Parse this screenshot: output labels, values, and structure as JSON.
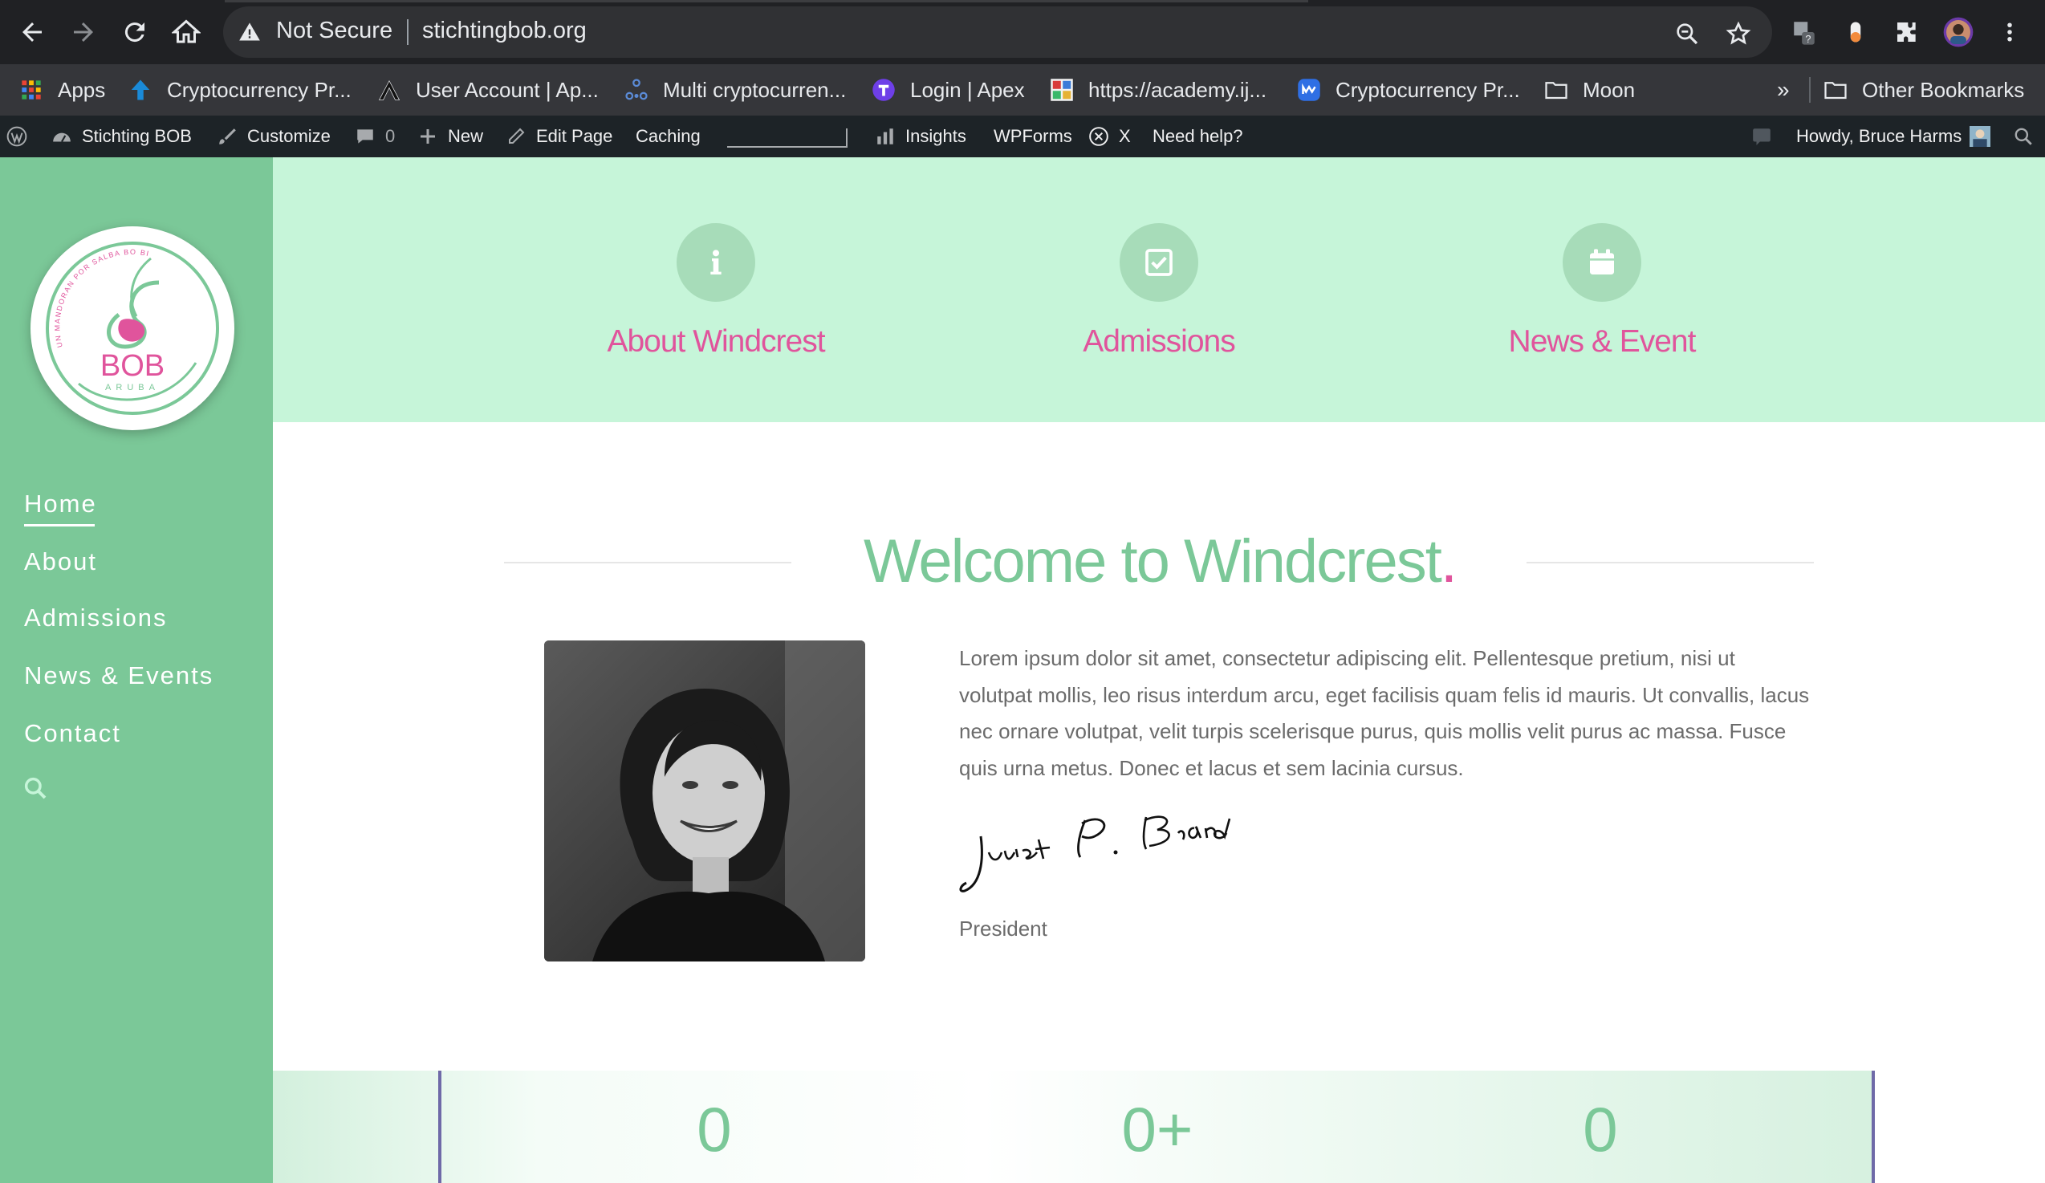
{
  "browser": {
    "security_label": "Not Secure",
    "url": "stichtingbob.org",
    "bookmarks": [
      {
        "label": "Apps",
        "icon": "apps-grid-icon"
      },
      {
        "label": "Cryptocurrency Pr...",
        "icon": "arrow-up-icon"
      },
      {
        "label": "User Account | Ap...",
        "icon": "apex-icon"
      },
      {
        "label": "Multi cryptocurren...",
        "icon": "dots-triangle-icon"
      },
      {
        "label": "Login | Apex",
        "icon": "t-circle-icon"
      },
      {
        "label": "https://academy.ij...",
        "icon": "academy-icon"
      },
      {
        "label": "Cryptocurrency Pr...",
        "icon": "coinmarketcap-icon"
      },
      {
        "label": "Moon",
        "icon": "folder-icon"
      }
    ],
    "bookmarks_overflow": "»",
    "other_bookmarks": "Other Bookmarks"
  },
  "admin_bar": {
    "site_name": "Stichting BOB",
    "customize": "Customize",
    "comments_count": "0",
    "new": "New",
    "edit_page": "Edit Page",
    "caching": "Caching",
    "insights": "Insights",
    "wpforms": "WPForms",
    "x_label": "X",
    "need_help": "Need help?",
    "howdy": "Howdy, Bruce Harms"
  },
  "logo": {
    "name": "BOB",
    "sub": "ARUBA",
    "tagline": "UN MANDORAN POR SALBA BO BIDA"
  },
  "sidebar": {
    "items": [
      {
        "label": "Home",
        "active": true
      },
      {
        "label": "About",
        "active": false
      },
      {
        "label": "Admissions",
        "active": false
      },
      {
        "label": "News & Events",
        "active": false
      },
      {
        "label": "Contact",
        "active": false
      }
    ]
  },
  "features": [
    {
      "title": "About Windcrest",
      "icon": "info-icon"
    },
    {
      "title": "Admissions",
      "icon": "check-square-icon"
    },
    {
      "title": "News & Event",
      "icon": "calendar-icon"
    }
  ],
  "welcome": {
    "title": "Welcome to Windcrest",
    "title_dot": ".",
    "body": "Lorem ipsum dolor sit amet, consectetur adipiscing elit. Pellentesque pretium, nisi ut volutpat mollis, leo risus interdum arcu, eget facilisis quam felis id mauris. Ut convallis, lacus nec ornare volutpat, velit turpis scelerisque purus, quis mollis velit purus ac massa. Fusce quis urna metus. Donec et lacus et sem lacinia cursus.",
    "signature": "Juliet P. Brand",
    "role": "President"
  },
  "counters": [
    "0",
    "0+",
    "0"
  ],
  "colors": {
    "green": "#7bc898",
    "mint": "#c6f5d9",
    "pink": "#e0549c",
    "admin_bar": "#1d2327"
  }
}
